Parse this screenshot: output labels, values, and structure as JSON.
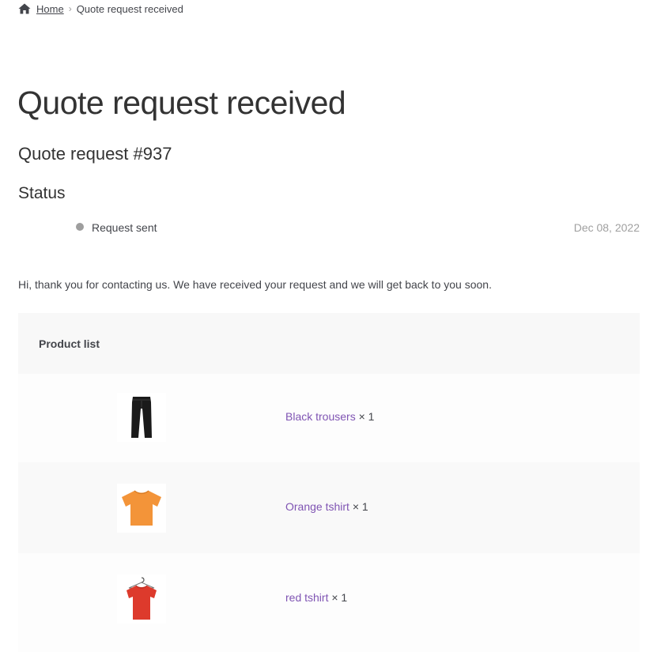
{
  "breadcrumb": {
    "home_icon": "home-icon",
    "home_label": "Home",
    "separator": "›",
    "current": "Quote request received"
  },
  "page": {
    "title": "Quote request received",
    "quote_number": "Quote request #937",
    "status_heading": "Status"
  },
  "status": {
    "label": "Request sent",
    "date": "Dec 08, 2022",
    "dot_color": "#9e9e9e"
  },
  "message": "Hi, thank you for contacting us. We have received your request and we will get back to you soon.",
  "product_list": {
    "header": "Product list",
    "items": [
      {
        "name": "Black trousers",
        "qty": "× 1",
        "icon": "trousers-icon",
        "color": "#1a1a1a"
      },
      {
        "name": "Orange tshirt",
        "qty": "× 1",
        "icon": "tshirt-icon",
        "color": "#f39439"
      },
      {
        "name": "red tshirt",
        "qty": "× 1",
        "icon": "tshirt-on-hanger-icon",
        "color": "#dd3a2c"
      }
    ]
  },
  "colors": {
    "link": "#7f54b3",
    "text": "#43454b",
    "header_bg": "#f8f8f8"
  }
}
